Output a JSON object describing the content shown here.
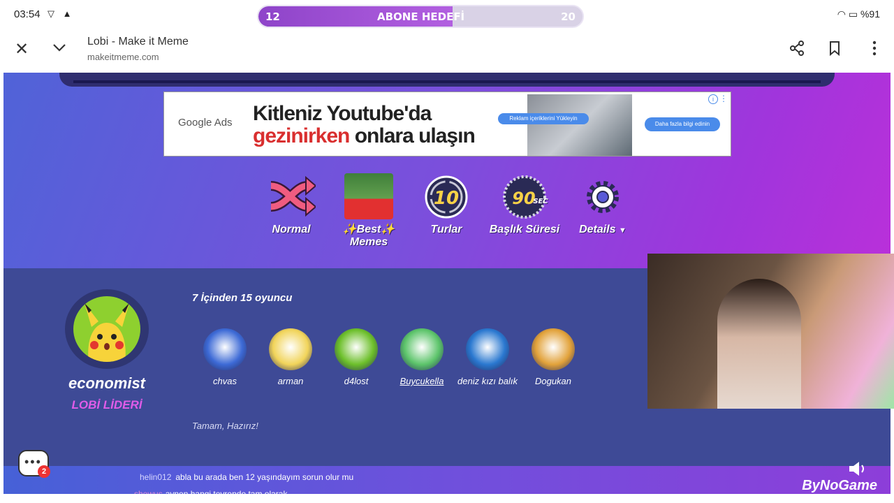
{
  "status": {
    "time": "03:54",
    "battery": "%91"
  },
  "sub_goal": {
    "current": "12",
    "label": "ABONE HEDEFİ",
    "target": "20",
    "progress": 0.6
  },
  "browser": {
    "title": "Lobi - Make it Meme",
    "url": "makeitmeme.com"
  },
  "ad": {
    "brand": "Google Ads",
    "line1": "Kitleniz Youtube'da",
    "line2_red": "gezinirken",
    "line2_rest": "onlara ulaşın",
    "pill1": "Reklam içeriklerini Yükleyin",
    "pill2": "Daha fazla bilgi edinin"
  },
  "options": [
    {
      "label": "Normal",
      "icon": "shuffle-icon"
    },
    {
      "label": "✨Best✨ Memes",
      "icon": "meme-thumb-icon"
    },
    {
      "label": "Turlar",
      "icon": "rounds-10-icon",
      "value": "10"
    },
    {
      "label": "Başlık Süresi",
      "icon": "timer-90-icon",
      "value": "90",
      "unit": "SEC"
    },
    {
      "label": "Details",
      "icon": "gear-icon"
    }
  ],
  "lobby": {
    "leader_name": "economist",
    "leader_role": "LOBİ LİDERİ",
    "count_text": "7 İçinden  15 oyuncu",
    "ready_text": "Tamam, Hazırız!",
    "players": [
      {
        "name": "chvas",
        "color": "#3d6ad6"
      },
      {
        "name": "arman",
        "color": "#f1d45a"
      },
      {
        "name": "d4lost",
        "color": "#6cbf2a"
      },
      {
        "name": "Buycukella",
        "color": "#5cc46a",
        "underline": true
      },
      {
        "name": "deniz kızı balık",
        "color": "#2a78d0"
      },
      {
        "name": "Dogukan",
        "color": "#e2a23a"
      }
    ]
  },
  "chat": {
    "unread": "2",
    "msg1_user": "helin012",
    "msg1_text": "abla bu arada ben 12 yaşındayım sorun olur mu",
    "msg2_user": "shewus",
    "msg2_text": "aynen hangi tevrende tam olarak"
  },
  "overlay_brand": "ByNoGame"
}
